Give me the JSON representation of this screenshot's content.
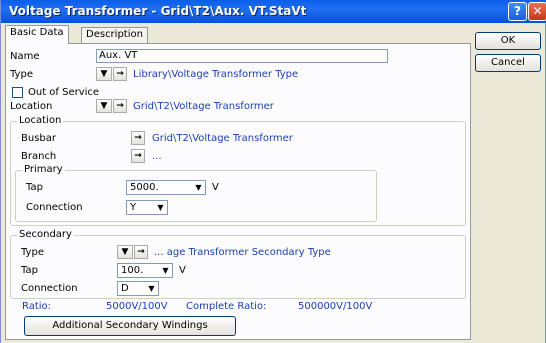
{
  "window": {
    "title": "Voltage Transformer - Grid\\T2\\Aux. VT.StaVt",
    "help_glyph": "?",
    "close_glyph": "✕"
  },
  "tabs": [
    {
      "label": "Basic Data"
    },
    {
      "label": "Description"
    }
  ],
  "buttons": {
    "ok": "OK",
    "cancel": "Cancel",
    "additional": "Additional Secondary Windings"
  },
  "form": {
    "name_label": "Name",
    "name_value": "Aux. VT",
    "type_label": "Type",
    "type_value": "Library\\Voltage Transformer Type",
    "out_of_service_label": "Out of Service",
    "location_label": "Location",
    "location_value": "Grid\\T2\\Voltage Transformer",
    "location_group": "Location",
    "busbar_label": "Busbar",
    "busbar_value": "Grid\\T2\\Voltage Transformer",
    "branch_label": "Branch",
    "branch_value": "...",
    "primary_group": "Primary",
    "primary_tap_label": "Tap",
    "primary_tap_value": "5000.",
    "primary_tap_unit": "V",
    "primary_conn_label": "Connection",
    "primary_conn_value": "Y",
    "secondary_group": "Secondary",
    "sec_type_label": "Type",
    "sec_type_value": "... age Transformer Secondary Type",
    "sec_tap_label": "Tap",
    "sec_tap_value": "100.",
    "sec_tap_unit": "V",
    "sec_conn_label": "Connection",
    "sec_conn_value": "D",
    "ratio_label": "Ratio:",
    "ratio_value": "5000V/100V",
    "complete_ratio_label": "Complete Ratio:",
    "complete_ratio_value": "500000V/100V"
  },
  "icons": {
    "select": "▼",
    "jump": "→",
    "dropdown": "▼"
  }
}
